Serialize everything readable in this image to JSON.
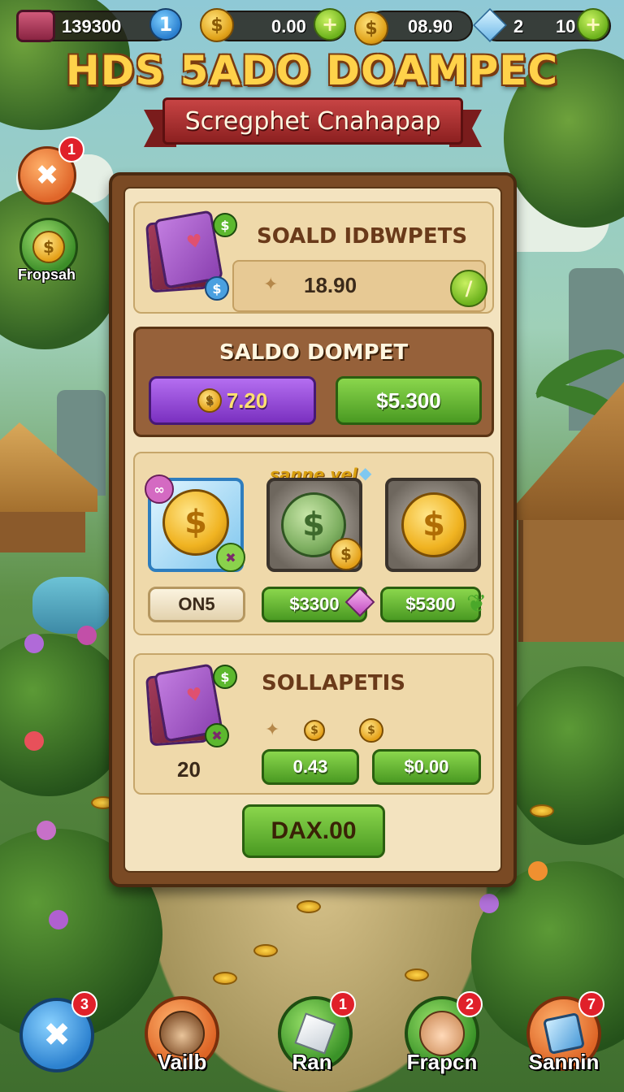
{
  "colors": {
    "panel_wood": "#7a4a24",
    "panel_cream": "#f3e3bf",
    "title_gold": "#ffd24a",
    "ribbon_red": "#c74444",
    "button_green": "#6cb21c",
    "button_purple": "#9a4ad8",
    "badge_red": "#e0202a"
  },
  "topbar": {
    "resource_1": {
      "icon": "chest-icon",
      "value": "139300",
      "button_label": "1"
    },
    "resource_2": {
      "icon": "coin-icon",
      "value": "0.00",
      "button_label": "+"
    },
    "resource_3": {
      "icon": "coin-stack-icon",
      "value": "08.90"
    },
    "resource_4": {
      "icon": "gem-icon",
      "value": "2",
      "value_2": "10",
      "button_label": "+"
    }
  },
  "header": {
    "title": "HDS 5ADO DOAMPEC",
    "subtitle": "Scregphet Cnahapap"
  },
  "side": {
    "top_button": {
      "icon": "tools-icon",
      "badge": "1"
    },
    "second_button": {
      "icon": "coin-badge-icon",
      "label": "Fropsah"
    }
  },
  "panel": {
    "section_1": {
      "heading": "SOALD IDBWPETS",
      "value": "18.90",
      "action_icon": "slash-icon"
    },
    "section_2": {
      "heading": "SALDO DOMPET",
      "left_button": "7.20",
      "right_button": "$5.300"
    },
    "section_3": {
      "promo_label": "sanne vel",
      "tiles": [
        {
          "icon": "gold-coin-icon",
          "price": "ON5"
        },
        {
          "icon": "green-coin-icon",
          "price": "$3300"
        },
        {
          "icon": "gold-coin-icon",
          "price": "$5300"
        }
      ]
    },
    "section_4": {
      "heading": "SOLLAPETIS",
      "count": "20",
      "left_button": "0.43",
      "right_button": "$0.00"
    },
    "main_button": "DAX.00"
  },
  "bottom_nav": [
    {
      "icon": "tools-icon",
      "label": "",
      "badge": "3"
    },
    {
      "icon": "wolf-avatar-icon",
      "label": "Vailb",
      "badge": ""
    },
    {
      "icon": "cube-icon",
      "label": "Ran",
      "badge": "1"
    },
    {
      "icon": "face-avatar-icon",
      "label": "Frapcn",
      "badge": "2"
    },
    {
      "icon": "gem-card-icon",
      "label": "Sannin",
      "badge": "7"
    }
  ]
}
